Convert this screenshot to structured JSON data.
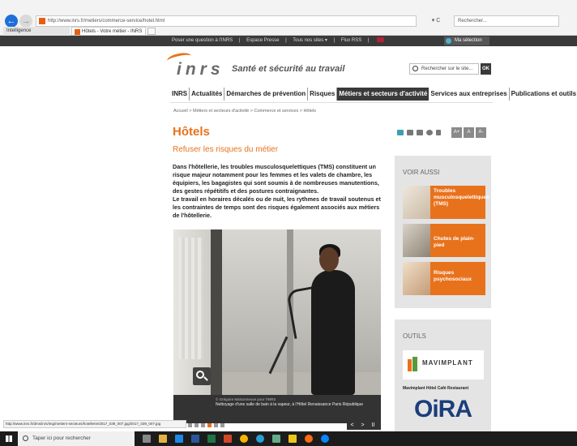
{
  "browser": {
    "url": "http://www.inrs.fr/metiers/commerce-service/hotel.html",
    "refresh_label": "▾ C",
    "search_placeholder": "Rechercher...",
    "tabs": [
      {
        "label": "Intelligence"
      },
      {
        "label": "Hôtels - Votre métier - INRS"
      }
    ]
  },
  "topbar": {
    "links": [
      "Poser une question à l'INRS",
      "|",
      "Espace Presse",
      "|",
      "Tous nos sites ▾",
      "|",
      "Flux RSS",
      "|"
    ],
    "my_selection": "Ma sélection"
  },
  "header": {
    "logo_text": "inrs",
    "tagline": "Santé et sécurité au travail",
    "search_placeholder": "Rechercher sur le site...",
    "ok_label": "OK"
  },
  "main_nav": [
    {
      "label": "INRS"
    },
    {
      "label": "Actualités"
    },
    {
      "label": "Démarches de prévention"
    },
    {
      "label": "Risques"
    },
    {
      "label": "Métiers et secteurs d'activité",
      "active": true
    },
    {
      "label": "Services aux entreprises"
    },
    {
      "label": "Publications et outils"
    }
  ],
  "breadcrumb": "Accueil  >  Métiers et secteurs d'activité  >  Commerce et services  >  Hôtels",
  "page": {
    "title": "Hôtels",
    "subtitle": "Refuser les risques du métier",
    "intro_p1": "Dans l'hôtellerie, les troubles musculosquelettiques (TMS) constituent un risque majeur notamment pour les femmes et les valets de chambre, les équipiers, les bagagistes qui sont soumis à de nombreuses manutentions, des gestes répétitifs et des postures contraignantes.",
    "intro_p2": "Le travail en horaires décalés ou de nuit, les rythmes de travail soutenus et les contraintes de temps sont des risques également associés aux métiers de l'hôtellerie."
  },
  "tools": {
    "font_buttons": [
      "A+",
      "A",
      "A-"
    ]
  },
  "photo": {
    "credit": "© Grégoire Maisonneuve pour l'INRS",
    "caption": "Nettoyage d'une salle de bain à la vapeur, à l'Hôtel Renaissance Paris République",
    "controls": [
      "<",
      ">",
      "II"
    ]
  },
  "sidebar": {
    "voir_aussi_title": "VOIR AUSSI",
    "related": [
      {
        "label": "Troubles musculosquelettiques (TMS)"
      },
      {
        "label": "Chutes de plain-pied"
      },
      {
        "label": "Risques psychosociaux"
      }
    ],
    "outils_title": "OUTILS",
    "mav_text": "MAVIMPLANT",
    "mav_caption": "Mavimplant Hôtel Café Restaurant",
    "oira_text": "OiRA"
  },
  "status_url": "http://www.inrs.fr/dms/inrs/img/metiers-secteurs/hotellerie/2017_039_007.jpg/2017_039_007.jpg",
  "taskbar": {
    "search_placeholder": "Taper ici pour rechercher"
  },
  "colors": {
    "accent": "#e8721c",
    "dark": "#3a3a3a",
    "oira_blue": "#1b3e7b"
  }
}
